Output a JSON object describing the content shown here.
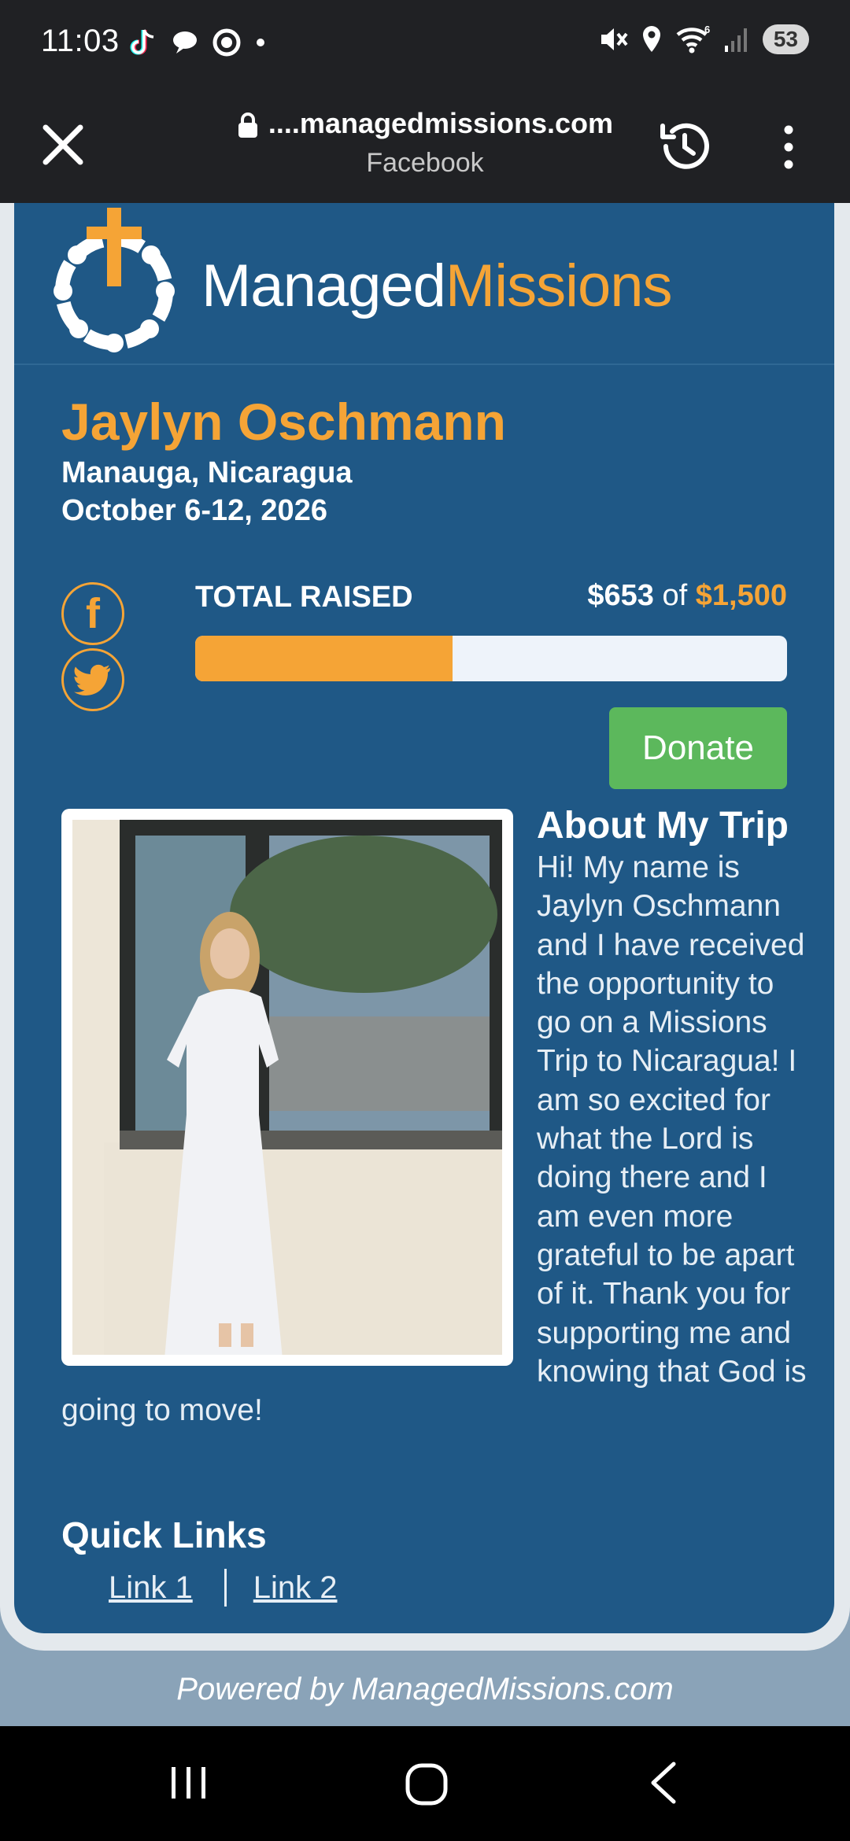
{
  "status_bar": {
    "time": "11:03",
    "battery": "53",
    "signal_label": "6"
  },
  "browser": {
    "url": "....managedmissions.com",
    "source": "Facebook"
  },
  "logo": {
    "part1": "Managed",
    "part2": "Missions"
  },
  "trip": {
    "name": "Jaylyn Oschmann",
    "location": "Manauga, Nicaragua",
    "dates": "October 6-12, 2026"
  },
  "fundraising": {
    "label": "TOTAL RAISED",
    "raised": "$653",
    "of": "of",
    "goal": "$1,500",
    "progress_fraction": 0.435
  },
  "donate_label": "Donate",
  "about": {
    "title": "About My Trip",
    "text": "Hi! My name is Jaylyn Oschmann and I have received the opportunity to go on a Missions Trip to Nicaragua! I am so excited for what the Lord is doing there and I am even more grateful to be apart of it. Thank you for supporting me and knowing that God is going to move!"
  },
  "quick_links": {
    "title": "Quick Links",
    "items": [
      "Link 1",
      "Link 2"
    ]
  },
  "footer": {
    "powered_by": "Powered by ManagedMissions.com"
  },
  "colors": {
    "accent": "#f5a436",
    "card": "#1f5886",
    "donate": "#5cb85c"
  },
  "icons": [
    "tiktok-icon",
    "chat-icon",
    "record-icon",
    "mute-icon",
    "location-icon",
    "wifi-icon",
    "signal-icon",
    "close-icon",
    "lock-icon",
    "history-icon",
    "more-icon",
    "facebook-icon",
    "twitter-icon",
    "recents-icon",
    "home-icon",
    "back-icon"
  ]
}
